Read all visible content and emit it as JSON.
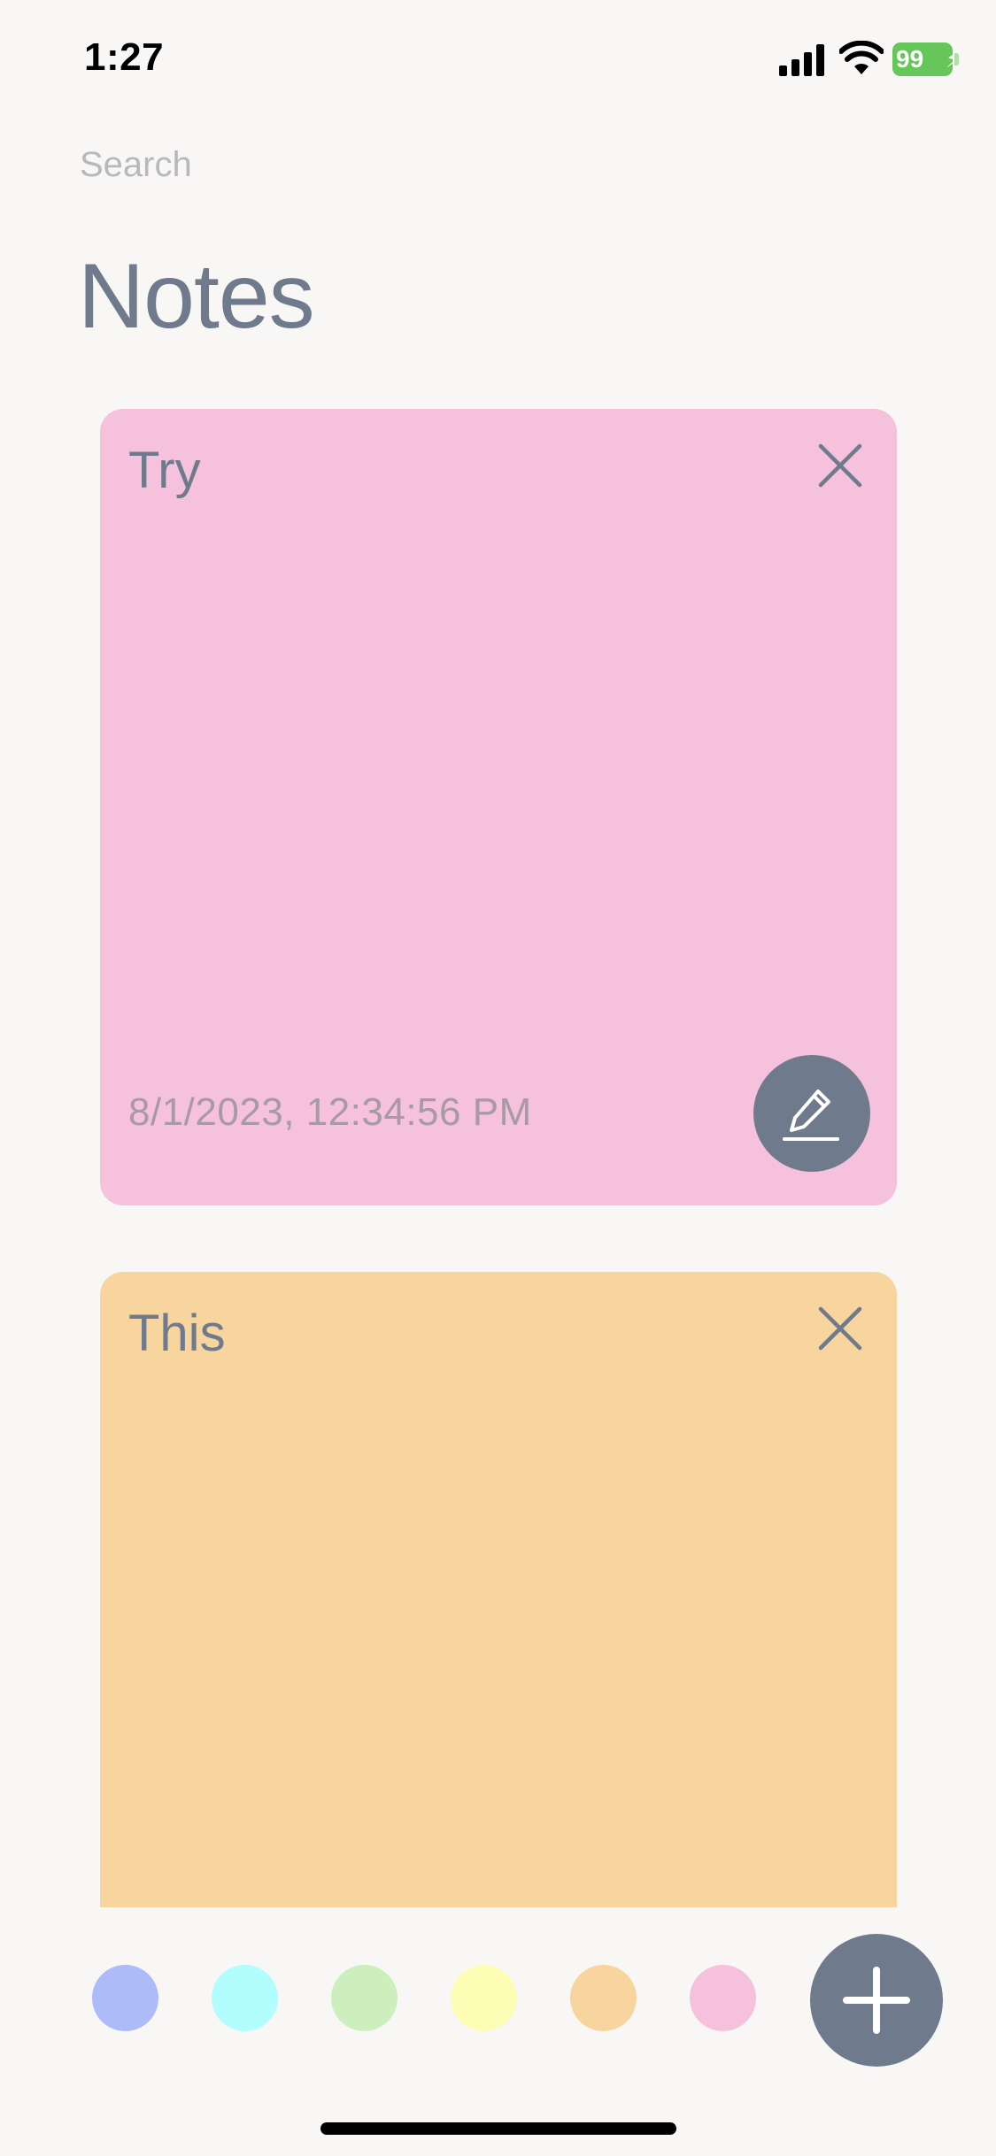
{
  "status_bar": {
    "time": "1:27",
    "battery_level": "99",
    "icons": [
      "signal-icon",
      "wifi-icon",
      "battery-charging-icon"
    ],
    "battery_color": "#67c65a"
  },
  "search": {
    "placeholder": "Search",
    "value": ""
  },
  "page_title": "Notes",
  "notes": [
    {
      "title": "Try",
      "date": "8/1/2023, 12:34:56 PM",
      "color": "#f5c1dc",
      "icons": [
        "close-icon",
        "pencil-icon"
      ]
    },
    {
      "title": "This",
      "date": "",
      "color": "#f8d59f",
      "icons": [
        "close-icon"
      ]
    }
  ],
  "color_palette": [
    {
      "name": "blue",
      "color": "#adbbf8"
    },
    {
      "name": "cyan",
      "color": "#b2fdfd"
    },
    {
      "name": "green",
      "color": "#cdefbd"
    },
    {
      "name": "yellow",
      "color": "#fdfdb6"
    },
    {
      "name": "orange",
      "color": "#f8d59f"
    },
    {
      "name": "pink",
      "color": "#f5c1dc"
    }
  ],
  "add_button_icon": "plus-icon",
  "accent_color": "#6f7b8c"
}
